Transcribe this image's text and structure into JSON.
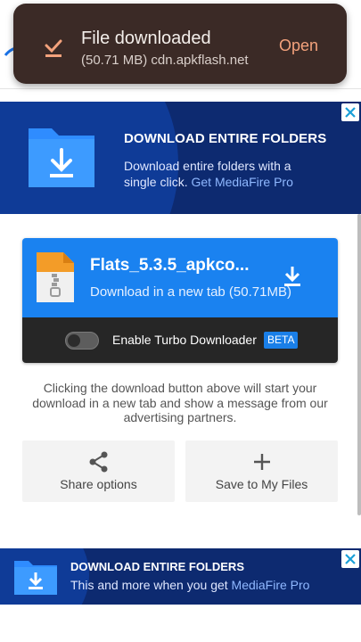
{
  "toast": {
    "title": "File downloaded",
    "subtitle": "(50.71 MB) cdn.apkflash.net",
    "action": "Open",
    "icon": "download-done-icon",
    "accent": "#f4a27c"
  },
  "ad_top": {
    "heading": "DOWNLOAD ENTIRE FOLDERS",
    "text": "Download entire folders with a single click.",
    "link": "Get MediaFire Pro"
  },
  "download_card": {
    "file_name": "Flats_5.3.5_apkco...",
    "subtitle": "Download in a new tab (50.71MB)",
    "toggle_label": "Enable Turbo Downloader",
    "badge": "BETA",
    "toggle_on": false,
    "accent": "#1a82f0"
  },
  "note": "Clicking the download button above will start your download in a new tab and show a message from our advertising partners.",
  "actions": {
    "share_label": "Share options",
    "save_label": "Save to My Files"
  },
  "ad_bottom": {
    "heading": "DOWNLOAD ENTIRE FOLDERS",
    "text": "This and more when you get",
    "link": "MediaFire Pro"
  }
}
